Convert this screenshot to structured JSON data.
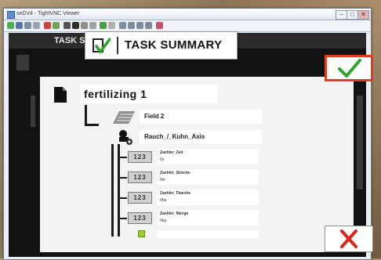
{
  "window": {
    "title": "seDV4 - TightVNC Viewer",
    "controls": {
      "minimize": "–",
      "maximize": "□",
      "close": "✕"
    }
  },
  "toolbar": {
    "icons": [
      "new-connection-icon",
      "save-icon",
      "options-icon",
      "info-icon",
      "pause-icon",
      "refresh-icon",
      "ctrl-alt-del-icon",
      "ctrl-esc-icon",
      "ctrl-icon",
      "alt-icon",
      "fullscreen-icon",
      "screenshot-icon",
      "zoom-in-icon",
      "zoom-out-icon",
      "zoom-100-icon",
      "zoom-fit-icon",
      "close-connection-icon"
    ]
  },
  "status": {
    "text": "TASK STATUS : PAUSED"
  },
  "summary": {
    "title": "TASK SUMMARY",
    "task_name": "fertilizing 1",
    "field": "Field 2",
    "implement": "Rauch_/_Kuhn_Axis",
    "counters": [
      {
        "icon_text": "123",
        "name": "Zaehler_Zeit",
        "value": "0s"
      },
      {
        "icon_text": "123",
        "name": "Zaehler_Strecke",
        "value": "0m"
      },
      {
        "icon_text": "123",
        "name": "Zaehler_Flaeche",
        "value": "0ha"
      },
      {
        "icon_text": "123",
        "name": "Zaehler_Menge",
        "value": "0kg"
      }
    ]
  },
  "colors": {
    "accent_red": "#e23b1d",
    "check_green": "#2aa52a",
    "cross_red": "#d8261b"
  }
}
